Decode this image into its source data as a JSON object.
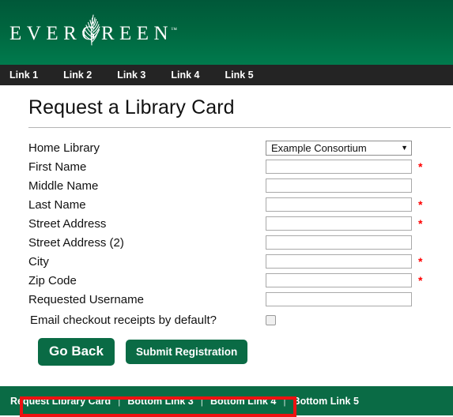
{
  "header": {
    "logo_text_left": "EVER",
    "logo_text_right": "GREEN",
    "logo_trademark": "™",
    "logo_icon": "fern-leaf-icon",
    "background_color": "#00663f"
  },
  "top_nav": {
    "links": [
      {
        "label": "Link 1"
      },
      {
        "label": "Link 2"
      },
      {
        "label": "Link 3"
      },
      {
        "label": "Link 4"
      },
      {
        "label": "Link 5"
      }
    ]
  },
  "main": {
    "page_title": "Request a Library Card"
  },
  "form": {
    "required_marker": "*",
    "rows": [
      {
        "label": "Home Library",
        "type": "select",
        "value": "Example Consortium",
        "required": false,
        "caret": "▼"
      },
      {
        "label": "First Name",
        "type": "text",
        "value": "",
        "required": true
      },
      {
        "label": "Middle Name",
        "type": "text",
        "value": "",
        "required": false
      },
      {
        "label": "Last Name",
        "type": "text",
        "value": "",
        "required": true
      },
      {
        "label": "Street Address",
        "type": "text",
        "value": "",
        "required": true
      },
      {
        "label": "Street Address (2)",
        "type": "text",
        "value": "",
        "required": false
      },
      {
        "label": "City",
        "type": "text",
        "value": "",
        "required": true
      },
      {
        "label": "Zip Code",
        "type": "text",
        "value": "",
        "required": true
      },
      {
        "label": "Requested Username",
        "type": "text",
        "value": "",
        "required": false
      }
    ],
    "checkbox_row": {
      "label": "Email checkout receipts by default?",
      "checked": false
    },
    "annotation": {
      "type": "highlight-rectangle",
      "color": "#ee1111"
    }
  },
  "buttons": {
    "go_back": "Go Back",
    "submit": "Submit Registration",
    "color": "#0a6b45"
  },
  "footer": {
    "links": [
      {
        "label": "Request Library Card"
      },
      {
        "label": "Bottom Link 3"
      },
      {
        "label": "Bottom Link 4"
      },
      {
        "label": "Bottom Link 5"
      }
    ],
    "separator": "|",
    "background_color": "#0a6b45"
  }
}
